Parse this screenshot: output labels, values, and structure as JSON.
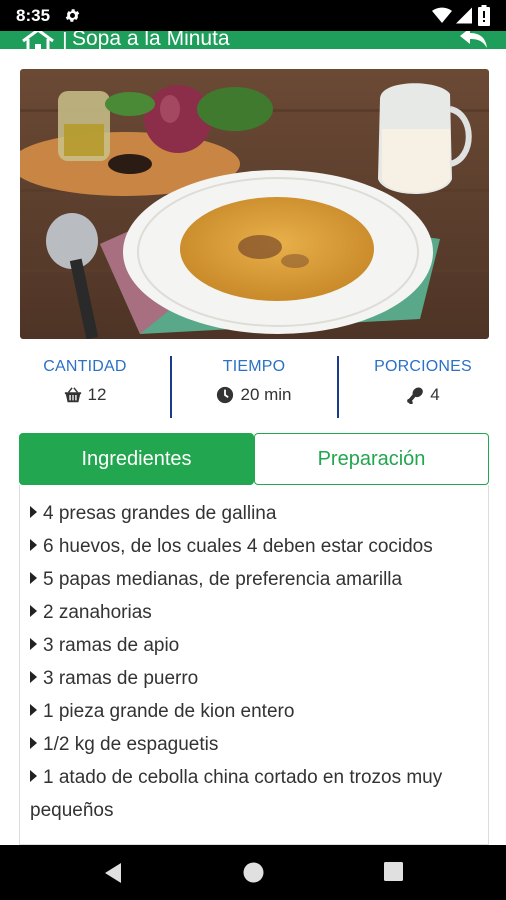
{
  "status_bar": {
    "time": "8:35",
    "icons": [
      "gear-icon",
      "wifi-icon",
      "signal-icon",
      "battery-icon"
    ]
  },
  "app_bar": {
    "title": "Sopa a la Minuta",
    "separator": "|",
    "icons": [
      "home-icon",
      "back-arrow-icon"
    ],
    "color": "#1e9e5a"
  },
  "stats": {
    "quantity": {
      "label": "CANTIDAD",
      "value": "12",
      "icon": "basket-icon"
    },
    "time": {
      "label": "TIEMPO",
      "value": "20 min",
      "icon": "clock-icon"
    },
    "portions": {
      "label": "PORCIONES",
      "value": "4",
      "icon": "drumstick-icon"
    }
  },
  "tabs": {
    "ingredients": "Ingredientes",
    "preparation": "Preparación",
    "active": "ingredients",
    "accent": "#22a64f"
  },
  "ingredients": [
    "4 presas grandes de gallina",
    "6 huevos, de los cuales 4 deben estar cocidos",
    "5 papas medianas, de preferencia amarilla",
    "2 zanahorias",
    "3 ramas de apio",
    "3 ramas de puerro",
    "1 pieza grande de kion entero",
    "1/2 kg de espaguetis",
    "1 atado de cebolla china cortado en trozos muy pequeños"
  ],
  "nav_bar": {
    "icons": [
      "back-triangle-icon",
      "home-circle-icon",
      "recents-square-icon"
    ]
  }
}
